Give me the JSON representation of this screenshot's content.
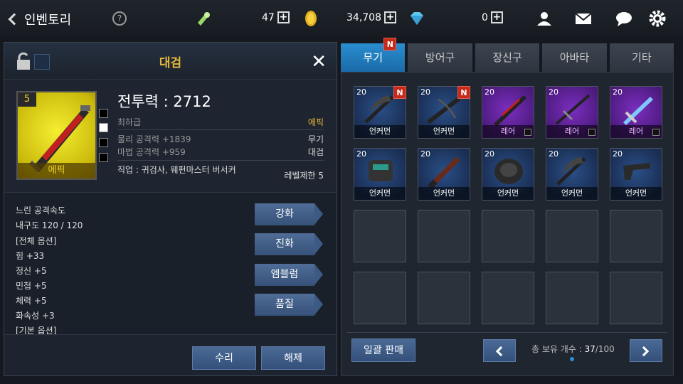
{
  "topbar": {
    "title": "인벤토리",
    "help": "?",
    "stamina": "47",
    "gold": "34,708",
    "gems": "0",
    "plus": "+"
  },
  "detail": {
    "title": "대검",
    "close": "✕",
    "grade_level": "5",
    "grade_label": "에픽",
    "power": "전투력 : 2712",
    "rank_label": "최하급",
    "rank_value": "에픽",
    "phys_atk": "물리 공격력 +1839",
    "type_label": "무기",
    "mag_atk": "마법 공격력 +959",
    "subtype": "대검",
    "job": "직업 : 귀검사, 웨펀마스터 버서커",
    "level_req": "레벨제한 5",
    "options": [
      "느린 공격속도",
      "내구도 120 / 120",
      "[전체 옵션]",
      "힘 +33",
      "정신 +5",
      "민첩 +5",
      "체력 +5",
      "화속성 +3",
      "[기본 옵션]"
    ],
    "buttons": [
      "강화",
      "진화",
      "엠블럼",
      "품질"
    ],
    "repair": "수리",
    "dismantle": "해제"
  },
  "tabs": [
    {
      "label": "무기",
      "active": true,
      "new": "N"
    },
    {
      "label": "방어구",
      "active": false
    },
    {
      "label": "장신구",
      "active": false
    },
    {
      "label": "아바타",
      "active": false
    },
    {
      "label": "기타",
      "active": false
    }
  ],
  "slots": [
    {
      "level": "20",
      "label": "언커먼",
      "grade": "uncommon",
      "new": "N",
      "icon": "scythe-icon"
    },
    {
      "level": "20",
      "label": "언커먼",
      "grade": "uncommon",
      "new": "N",
      "icon": "crossbow-icon"
    },
    {
      "level": "20",
      "label": "레어",
      "grade": "rare",
      "icon": "greatsword-icon"
    },
    {
      "level": "20",
      "label": "레어",
      "grade": "rare",
      "icon": "katana-icon"
    },
    {
      "level": "20",
      "label": "레어",
      "grade": "rare",
      "icon": "bluesword-icon"
    },
    {
      "level": "20",
      "label": "언커먼",
      "grade": "uncommon",
      "icon": "gauntlet-icon"
    },
    {
      "level": "20",
      "label": "언커먼",
      "grade": "uncommon",
      "icon": "club-icon"
    },
    {
      "level": "20",
      "label": "언커먼",
      "grade": "uncommon",
      "icon": "glove-icon"
    },
    {
      "level": "20",
      "label": "언커먼",
      "grade": "uncommon",
      "icon": "scythe-icon"
    },
    {
      "level": "20",
      "label": "언커먼",
      "grade": "uncommon",
      "icon": "pistol-icon"
    }
  ],
  "footer": {
    "sell_all": "일괄 판매",
    "count_label": "총 보유 개수 : ",
    "count_current": "37",
    "count_max": "/100"
  },
  "colors": {
    "epic": "#e5b73a",
    "accent": "#2a8ed0",
    "rare": "#7b2ec0",
    "new_badge": "#c52a1a"
  }
}
